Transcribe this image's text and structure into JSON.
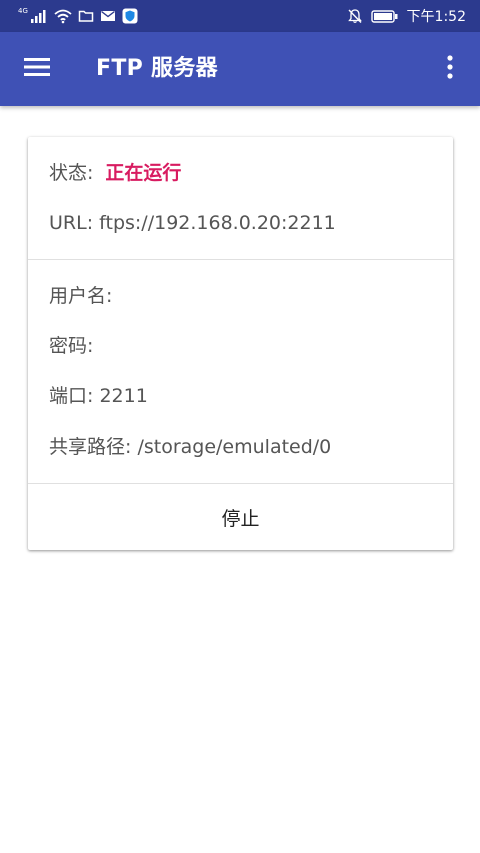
{
  "status_bar": {
    "network_label": "4G",
    "time": "下午1:52"
  },
  "app_bar": {
    "title": "FTP 服务器"
  },
  "card": {
    "status_label": "状态:",
    "status_value": "正在运行",
    "url_line": "URL: ftps://192.168.0.20:2211",
    "username_line": "用户名:",
    "password_line": "密码:",
    "port_line": "端口: 2211",
    "share_path_line": "共享路径: /storage/emulated/0",
    "stop_label": "停止"
  },
  "colors": {
    "status_bar": "#2c3a8e",
    "app_bar": "#3f51b5",
    "status_running": "#d81b60"
  }
}
